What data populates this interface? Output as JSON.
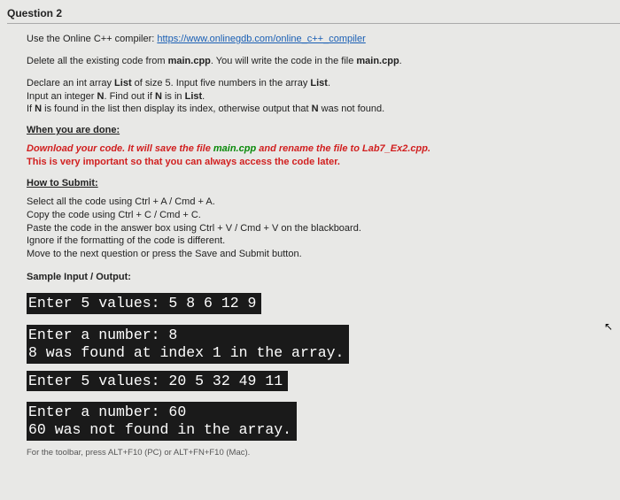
{
  "question_label": "Question 2",
  "intro": {
    "prefix": "Use the Online C++ compiler: ",
    "link": "https://www.onlinegdb.com/online_c++_compiler"
  },
  "delete_line": {
    "p1": "Delete all the existing code from ",
    "f1": "main.cpp",
    "p2": ". You will write the code in the file ",
    "f2": "main.cpp",
    "p3": "."
  },
  "declare": {
    "l1a": "Declare an int array ",
    "l1b": "List",
    "l1c": " of size 5. Input five numbers in the array ",
    "l1d": "List",
    "l1e": ".",
    "l2a": "Input an integer ",
    "l2b": "N",
    "l2c": ". Find out if ",
    "l2d": "N",
    "l2e": " is in ",
    "l2f": "List",
    "l2g": ".",
    "l3a": "If ",
    "l3b": "N",
    "l3c": " is found in the list then display its index, otherwise output that ",
    "l3d": "N",
    "l3e": " was not found."
  },
  "when_done": "When you are done:",
  "download": {
    "l1a": "Download your code. It will save the file ",
    "l1b": "main.cpp",
    "l1c": " and rename the file to ",
    "l1d": "Lab7_Ex2.cpp",
    "l1e": ".",
    "l2": "This is very important so that you can always access the code later."
  },
  "how_submit": "How to Submit:",
  "submit_steps": {
    "s1": "Select all the code using Ctrl + A / Cmd + A.",
    "s2": "Copy the code using Ctrl + C / Cmd + C.",
    "s3": "Paste the code in the answer box using Ctrl + V / Cmd + V on the blackboard.",
    "s4": "Ignore if the formatting of the code is different.",
    "s5": "Move to the next question or press the Save and Submit button."
  },
  "sample_head": "Sample Input / Output:",
  "term": {
    "t1": "Enter 5 values: 5 8 6 12 9",
    "t2a": "Enter a number: 8",
    "t2b": "8 was found at index 1 in the array.",
    "t3": "Enter 5 values: 20 5 32 49 11",
    "t4a": "Enter a number: 60",
    "t4b": "60 was not found in the array."
  },
  "footer": "For the toolbar, press ALT+F10 (PC) or ALT+FN+F10 (Mac)."
}
